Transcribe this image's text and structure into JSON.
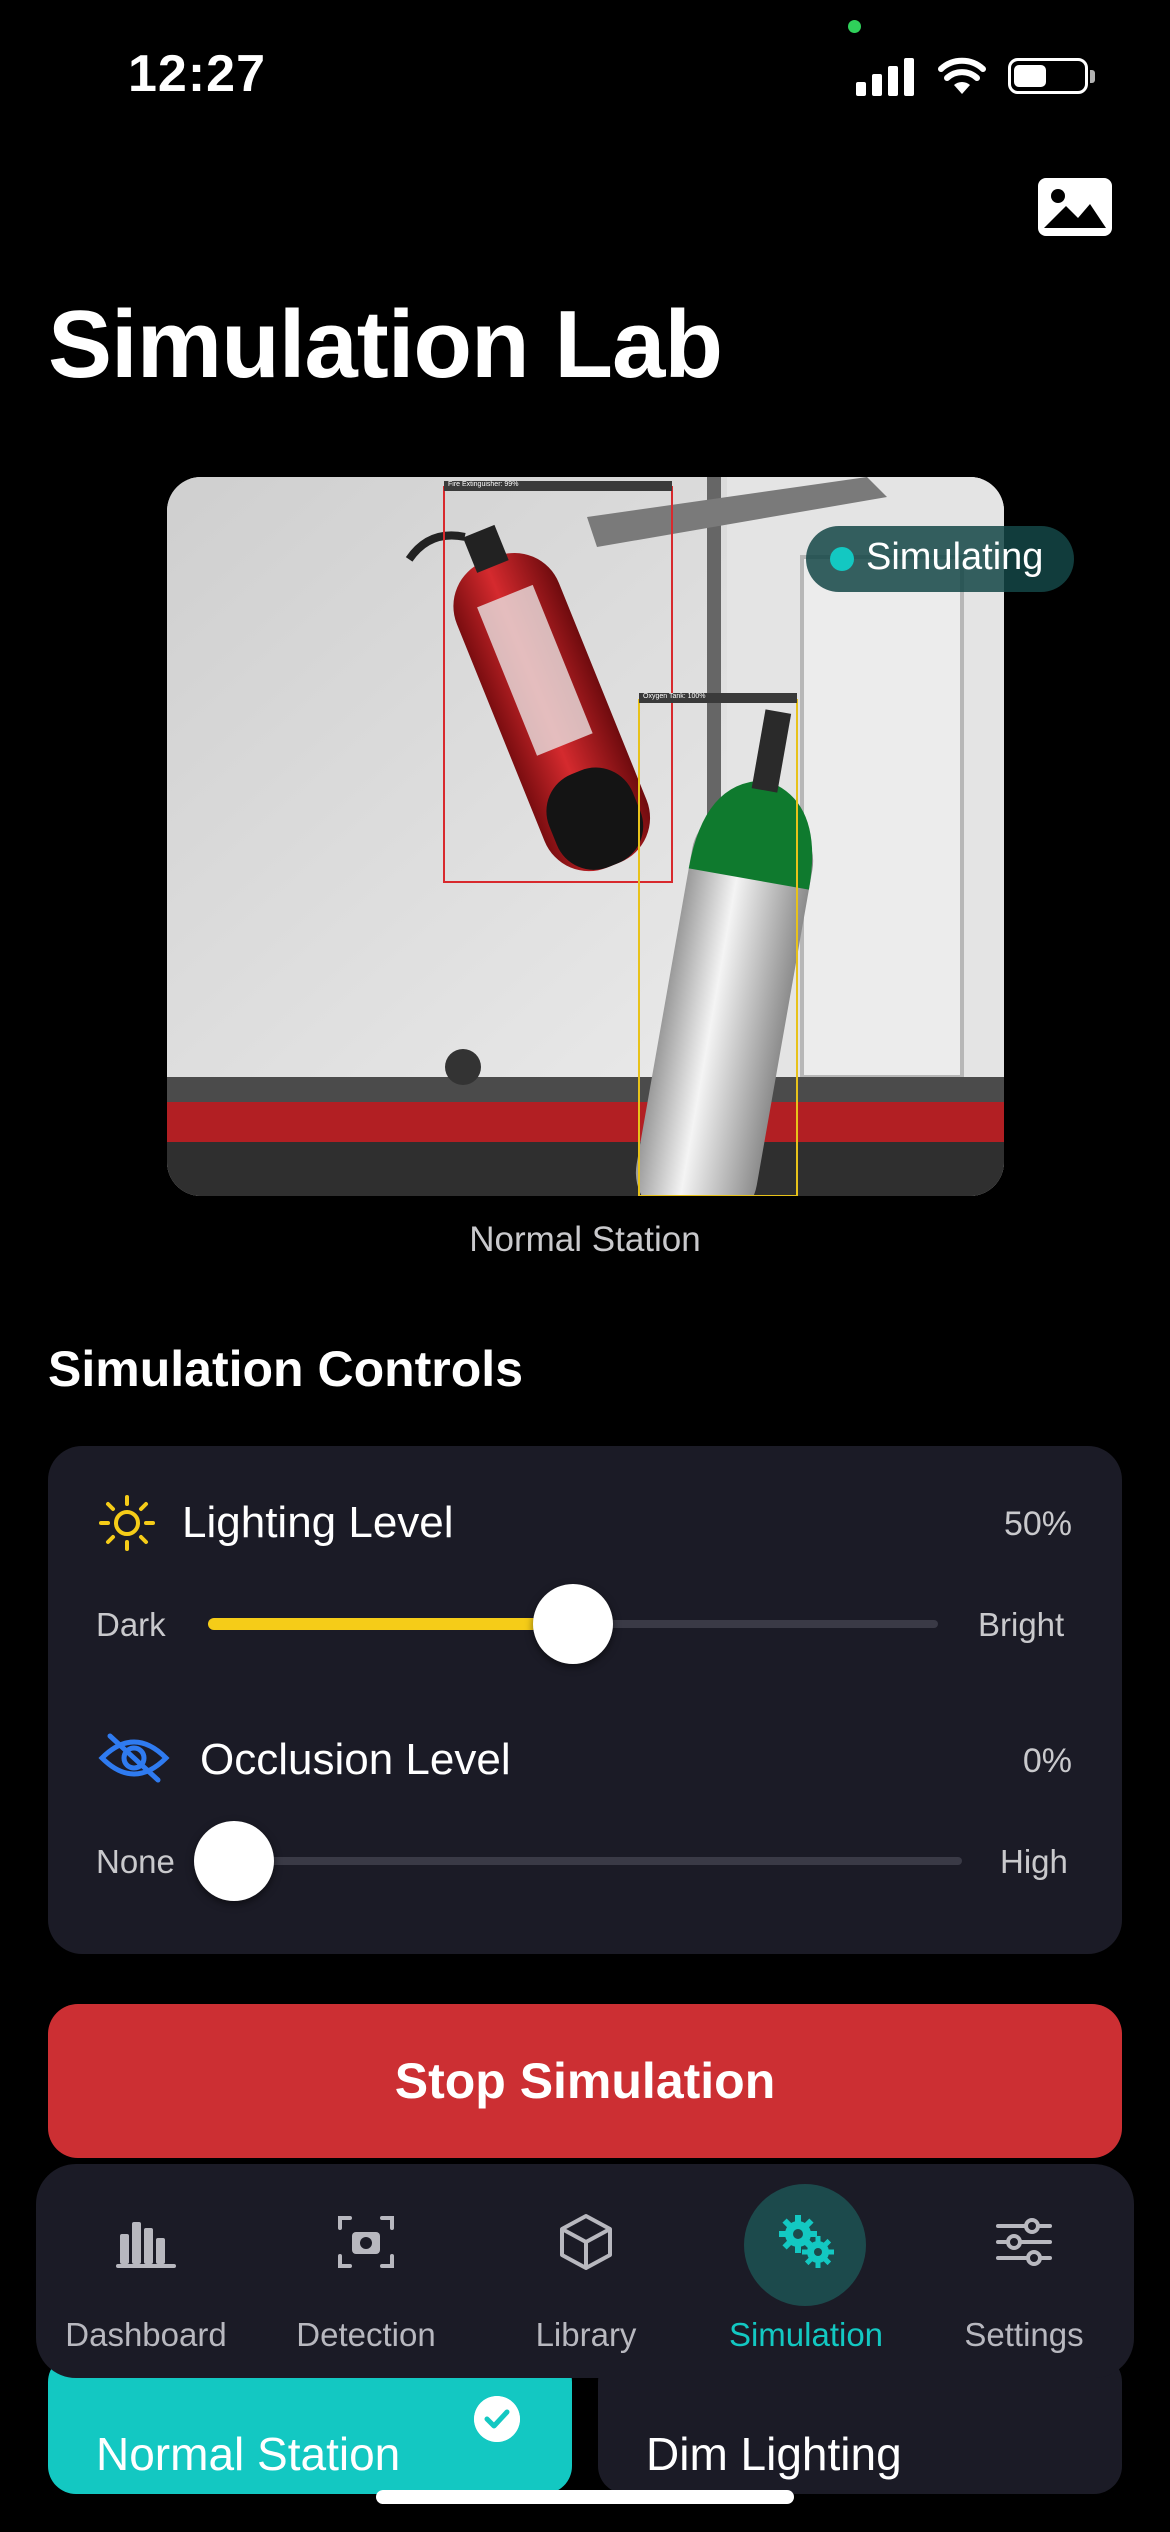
{
  "status_bar": {
    "time": "12:27"
  },
  "page": {
    "title": "Simulation Lab"
  },
  "preview": {
    "status": "Simulating",
    "caption": "Normal Station",
    "detections": [
      {
        "label": "Fire Extinguisher: 99%",
        "color": "#d8292d"
      },
      {
        "label": "Oxygen Tank: 100%",
        "color": "#e8c21a"
      }
    ]
  },
  "controls": {
    "section_title": "Simulation Controls",
    "lighting": {
      "label": "Lighting Level",
      "value": "50%",
      "min_label": "Dark",
      "max_label": "Bright",
      "level": 0.5,
      "icon": "sun-icon",
      "color": "#f5cc18"
    },
    "occlusion": {
      "label": "Occlusion Level",
      "value": "0%",
      "min_label": "None",
      "max_label": "High",
      "level": 0.0,
      "icon": "eye-slash-icon",
      "color": "#2f7bf0"
    }
  },
  "actions": {
    "stop_label": "Stop Simulation",
    "stop_color": "#cc2f33"
  },
  "scenarios": [
    {
      "label": "Normal Station",
      "selected": true
    },
    {
      "label": "Dim Lighting",
      "selected": false
    }
  ],
  "tabs": [
    {
      "label": "Dashboard",
      "icon": "bar-chart-icon",
      "active": false
    },
    {
      "label": "Detection",
      "icon": "camera-scan-icon",
      "active": false
    },
    {
      "label": "Library",
      "icon": "cube-icon",
      "active": false
    },
    {
      "label": "Simulation",
      "icon": "gears-icon",
      "active": true
    },
    {
      "label": "Settings",
      "icon": "sliders-icon",
      "active": false
    }
  ],
  "colors": {
    "accent": "#13c8c2",
    "card": "#1b1b26",
    "background": "#000000"
  }
}
